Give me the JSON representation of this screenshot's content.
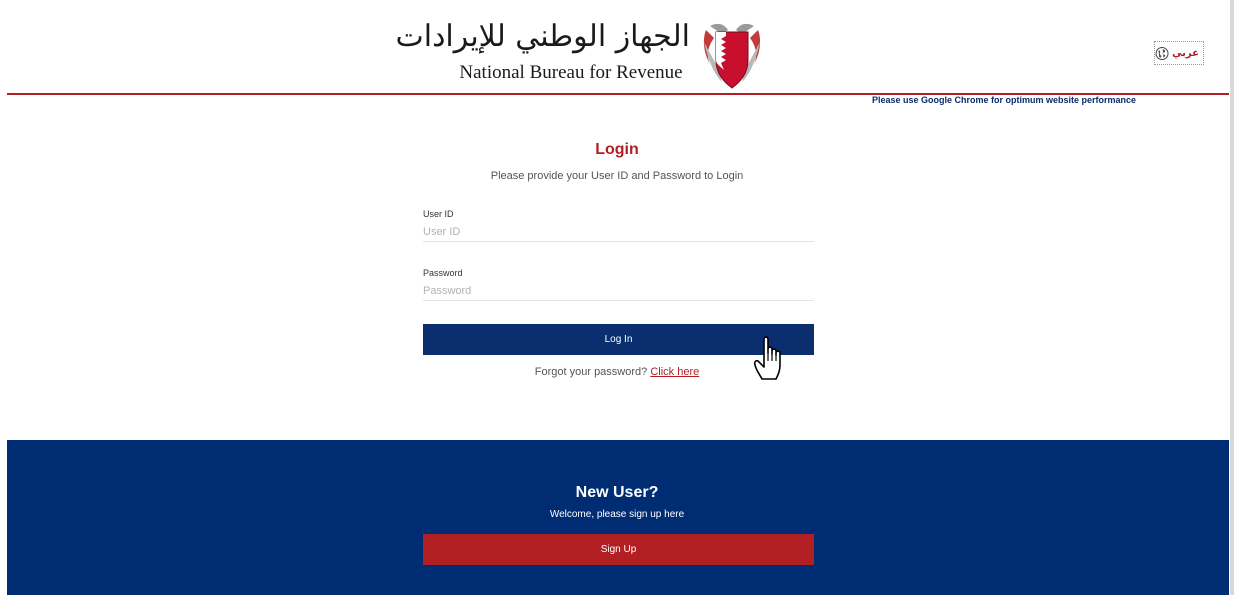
{
  "header": {
    "logo_arabic": "الجهاز الوطني للإيرادات",
    "logo_english": "National Bureau for Revenue",
    "browser_note": "Please use Google Chrome for optimum website performance",
    "language_switch": "عربي"
  },
  "login": {
    "title": "Login",
    "subtitle": "Please provide your User ID and Password to Login",
    "user_id_label": "User ID",
    "user_id_placeholder": "User ID",
    "password_label": "Password",
    "password_placeholder": "Password",
    "button_label": "Log In",
    "forgot_text": "Forgot your password?",
    "forgot_link": "Click here"
  },
  "signup": {
    "title": "New User?",
    "subtitle": "Welcome, please sign up here",
    "button_label": "Sign Up"
  },
  "colors": {
    "brand_red": "#b11f24",
    "brand_navy": "#002c73",
    "button_navy": "#0a2e6e"
  },
  "icons": {
    "emblem": "bahrain-emblem-icon",
    "language": "globe-icon",
    "pointer": "hand-cursor-icon"
  }
}
